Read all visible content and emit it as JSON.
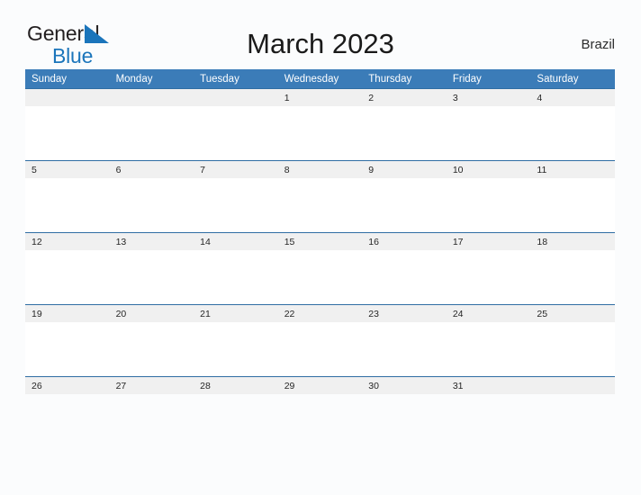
{
  "logo": {
    "line1": "General",
    "line2": "Blue",
    "accent_color": "#1b75bb",
    "text_color": "#231f20"
  },
  "header": {
    "title": "March 2023",
    "region": "Brazil"
  },
  "calendar": {
    "header_bg": "#3b7cb8",
    "date_strip_bg": "#f0f0f0",
    "rule_color": "#2f6da3",
    "weekdays": [
      "Sunday",
      "Monday",
      "Tuesday",
      "Wednesday",
      "Thursday",
      "Friday",
      "Saturday"
    ],
    "weeks": [
      [
        "",
        "",
        "",
        "1",
        "2",
        "3",
        "4"
      ],
      [
        "5",
        "6",
        "7",
        "8",
        "9",
        "10",
        "11"
      ],
      [
        "12",
        "13",
        "14",
        "15",
        "16",
        "17",
        "18"
      ],
      [
        "19",
        "20",
        "21",
        "22",
        "23",
        "24",
        "25"
      ],
      [
        "26",
        "27",
        "28",
        "29",
        "30",
        "31",
        ""
      ]
    ]
  }
}
